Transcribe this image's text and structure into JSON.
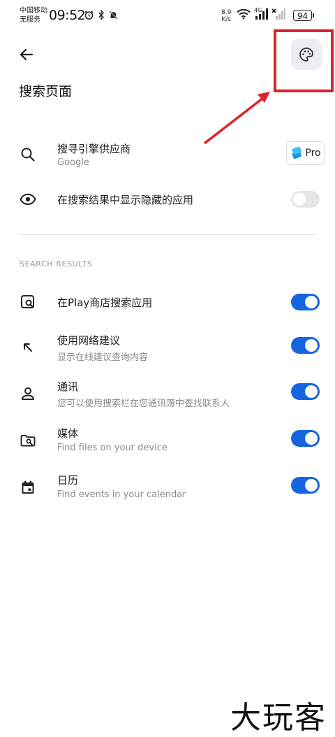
{
  "status_bar": {
    "carrier_line1": "中国移动",
    "carrier_line2": "无服务",
    "time": "09:52",
    "speed_value": "8.9",
    "speed_unit": "K/s",
    "network_type": "4G",
    "battery": "94"
  },
  "header": {
    "title": "搜索页面"
  },
  "settings": {
    "search_provider": {
      "label": "搜寻引擎供应商",
      "value": "Google",
      "badge": "Pro"
    },
    "show_hidden_apps": {
      "label": "在搜索结果中显示隐藏的应用",
      "enabled": false
    }
  },
  "search_results": {
    "header": "SEARCH RESULTS",
    "items": [
      {
        "label": "在Play商店搜索应用",
        "sub": "",
        "enabled": true
      },
      {
        "label": "使用网络建议",
        "sub": "显示在线建议查询内容",
        "enabled": true
      },
      {
        "label": "通讯",
        "sub": "您可以使用搜索栏在您通讯簿中查找联系人",
        "enabled": true
      },
      {
        "label": "媒体",
        "sub": "Find files on your device",
        "enabled": true
      },
      {
        "label": "日历",
        "sub": "Find events in your calendar",
        "enabled": true
      }
    ]
  },
  "watermark": "大玩客",
  "colors": {
    "accent": "#1565e0",
    "annotation_red": "#e0222a",
    "toggle_off": "#e6e6e6"
  }
}
